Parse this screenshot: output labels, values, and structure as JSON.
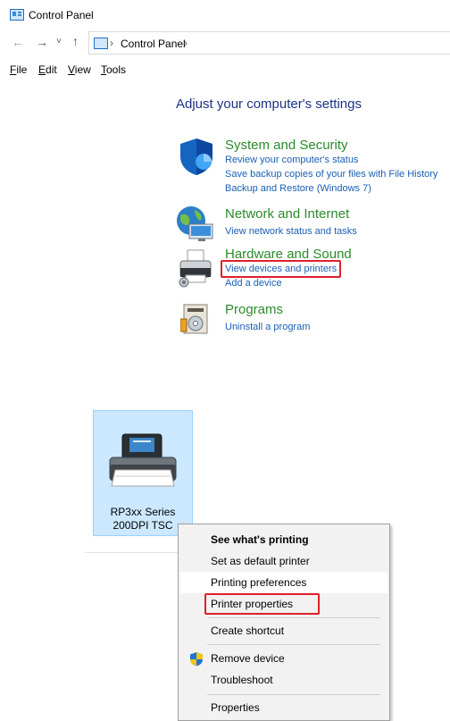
{
  "window": {
    "title": "Control Panel"
  },
  "address": {
    "path": "Control Panel",
    "separator": "›"
  },
  "nav": {
    "back": "←",
    "forward": "→",
    "recent": "˅",
    "up": "↑"
  },
  "menubar": [
    {
      "accel": "F",
      "rest": "ile"
    },
    {
      "accel": "E",
      "rest": "dit"
    },
    {
      "accel": "V",
      "rest": "iew"
    },
    {
      "accel": "T",
      "rest": "ools"
    }
  ],
  "settings": {
    "heading": "Adjust your computer's settings",
    "categories": [
      {
        "title": "System and Security",
        "icon": "shield-icon",
        "links": [
          "Review your computer's status",
          "Save backup copies of your files with File History",
          "Backup and Restore (Windows 7)"
        ]
      },
      {
        "title": "Network and Internet",
        "icon": "globe-icon",
        "links": [
          "View network status and tasks"
        ]
      },
      {
        "title": "Hardware and Sound",
        "icon": "printer-icon",
        "links": [
          "View devices and printers",
          "Add a device"
        ]
      },
      {
        "title": "Programs",
        "icon": "programs-icon",
        "links": [
          "Uninstall a program"
        ]
      }
    ]
  },
  "device": {
    "name_line1": "RP3xx Series",
    "name_line2": "200DPI TSC",
    "icon": "printer-device-icon"
  },
  "context_menu": {
    "items": [
      "See what's printing",
      "Set as default printer",
      "Printing preferences",
      "Printer properties",
      "Create shortcut",
      "Remove device",
      "Troubleshoot",
      "Properties"
    ]
  },
  "colors": {
    "link": "#1a5fb4",
    "category_title": "#2b8a2b",
    "heading": "#1e3287",
    "highlight_box": "#e0202a",
    "selection": "#cce8ff"
  }
}
